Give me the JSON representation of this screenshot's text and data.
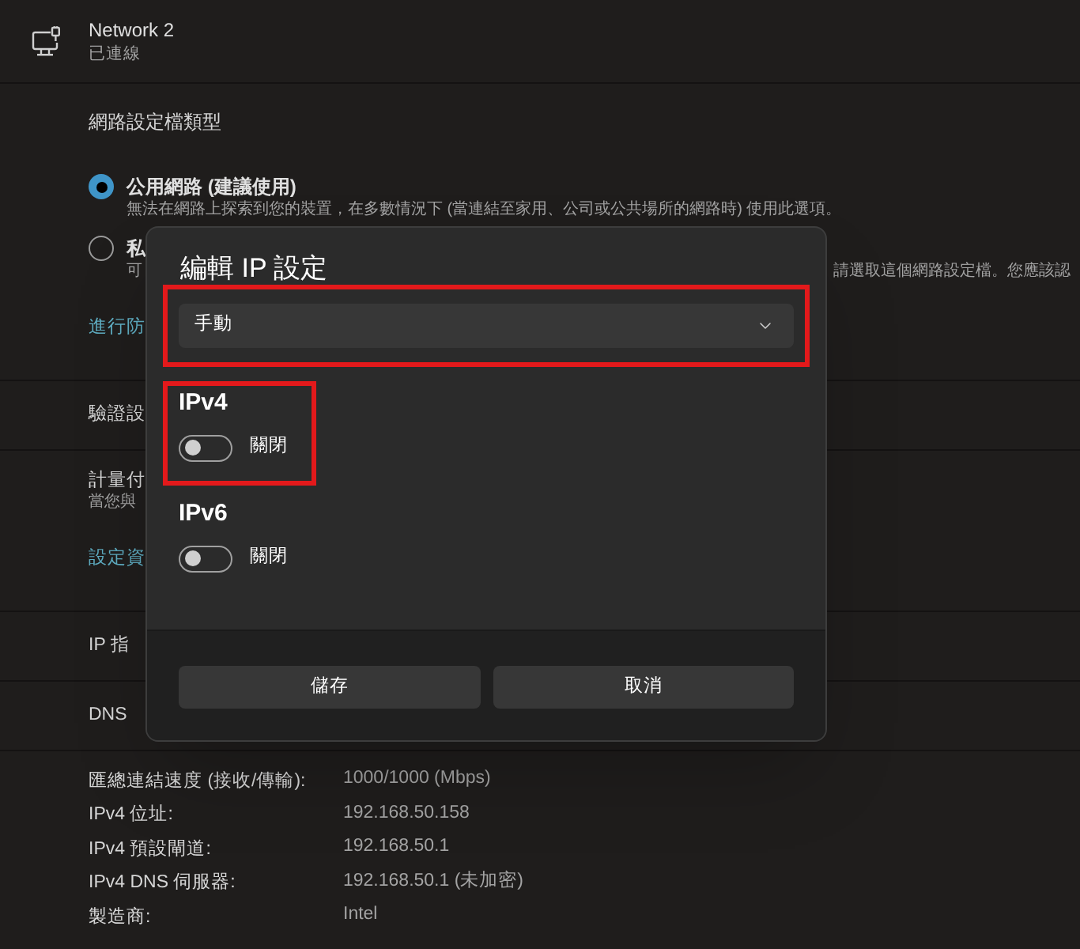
{
  "connection": {
    "name": "Network 2",
    "status": "已連線"
  },
  "profile_type": {
    "heading": "網路設定檔類型",
    "options": [
      {
        "label": "公用網路 (建議使用)",
        "description": "無法在網路上探索到您的裝置，在多數情況下 (當連結至家用、公司或公共場所的網路時) 使用此選項。",
        "selected": true
      },
      {
        "label": "私",
        "description": "可",
        "description_end": "請選取這個網路設定檔。您應該認",
        "selected": false
      }
    ],
    "link": "進行防"
  },
  "authentication": {
    "label": "驗證設"
  },
  "metered": {
    "label": "計量付",
    "description": "當您與",
    "link": "設定資"
  },
  "ip_assignment": {
    "label": "IP 指"
  },
  "dns_assignment": {
    "label": "DNS"
  },
  "details": [
    {
      "label": "匯總連結速度 (接收/傳輸):",
      "value": "1000/1000 (Mbps)"
    },
    {
      "label": "IPv4 位址:",
      "value": "192.168.50.158"
    },
    {
      "label": "IPv4 預設閘道:",
      "value": "192.168.50.1"
    },
    {
      "label": "IPv4 DNS 伺服器:",
      "value": "192.168.50.1 (未加密)"
    },
    {
      "label": "製造商:",
      "value": "Intel"
    }
  ],
  "dialog": {
    "title": "編輯 IP 設定",
    "dropdown": {
      "value": "手動",
      "highlighted": true
    },
    "sections": [
      {
        "heading": "IPv4",
        "on": false,
        "state_label": "關閉",
        "highlighted": true
      },
      {
        "heading": "IPv6",
        "on": false,
        "state_label": "關閉",
        "highlighted": false
      }
    ],
    "buttons": [
      "儲存",
      "取消"
    ]
  }
}
